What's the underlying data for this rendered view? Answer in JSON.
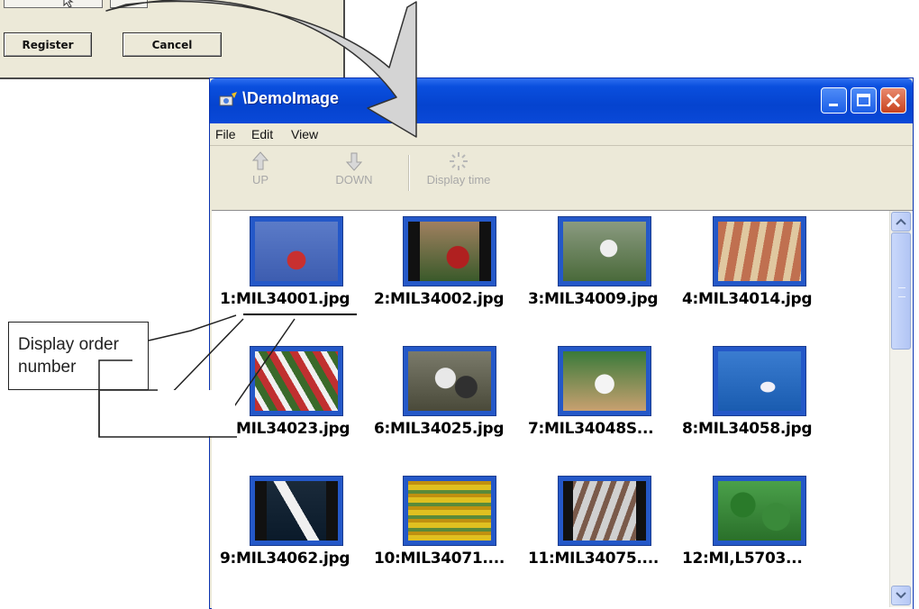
{
  "dialog": {
    "register_label": "Register",
    "cancel_label": "Cancel"
  },
  "window": {
    "title": "\\DemoImage",
    "menu": [
      "File",
      "Edit",
      "View"
    ],
    "toolbar": {
      "up_label": "UP",
      "down_label": "DOWN",
      "display_time_label": "Display time"
    }
  },
  "thumbnails": [
    {
      "caption": "1:MIL34001.jpg",
      "scene": "soccer-players-red"
    },
    {
      "caption": "2:MIL34002.jpg",
      "scene": "soccer-header"
    },
    {
      "caption": "3:MIL34009.jpg",
      "scene": "soccer-tackle"
    },
    {
      "caption": "4:MIL34014.jpg",
      "scene": "sprinters"
    },
    {
      "caption": "5:MIL34023.jpg",
      "scene": "football-players"
    },
    {
      "caption": "6:MIL34025.jpg",
      "scene": "american-football"
    },
    {
      "caption": "7:MIL34048S...",
      "scene": "tennis-player"
    },
    {
      "caption": "8:MIL34058.jpg",
      "scene": "water-skier"
    },
    {
      "caption": "9:MIL34062.jpg",
      "scene": "sailboat"
    },
    {
      "caption": "10:MIL34071....",
      "scene": "flower-field"
    },
    {
      "caption": "11:MIL34075....",
      "scene": "cyclists"
    },
    {
      "caption": "12:MI,L5703...",
      "scene": "clover-leaves"
    }
  ],
  "annotation": {
    "line1": "Display order",
    "line2": "number"
  },
  "colors": {
    "titlebar": "#0a4fde",
    "thumb_frame": "#2458c8",
    "arrow_fill": "#d4d4d4"
  }
}
